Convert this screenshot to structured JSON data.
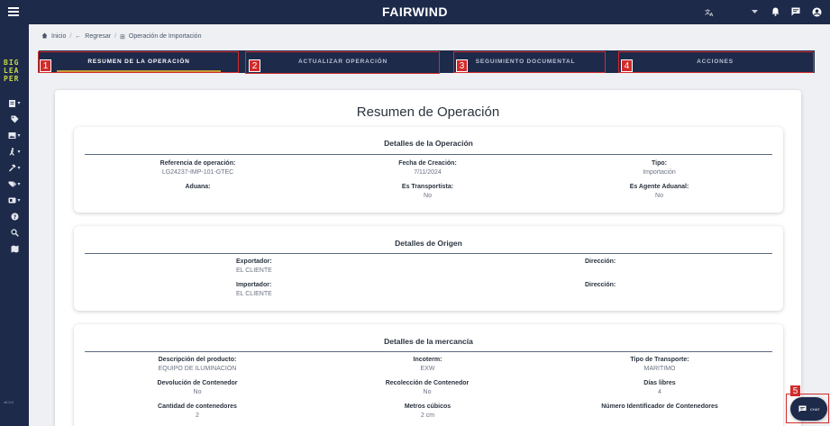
{
  "header": {
    "brand": "FAIRWIND",
    "icons": [
      "menu-icon",
      "translate-icon",
      "chevron-down-icon",
      "bell-icon",
      "message-icon",
      "account-icon"
    ]
  },
  "sidebar": {
    "logo": [
      "BIG",
      "LEA",
      "PER"
    ],
    "items": [
      {
        "icon": "clipboard-icon",
        "caret": true
      },
      {
        "icon": "tag-icon",
        "caret": false
      },
      {
        "icon": "image-icon",
        "caret": true
      },
      {
        "icon": "person-run-icon",
        "caret": true
      },
      {
        "icon": "hammer-icon",
        "caret": true
      },
      {
        "icon": "tags-icon",
        "caret": true
      },
      {
        "icon": "document-icon",
        "caret": true
      },
      {
        "icon": "help-icon",
        "caret": false
      },
      {
        "icon": "search-icon",
        "caret": false
      },
      {
        "icon": "map-icon",
        "caret": false
      }
    ],
    "footer": "v0.0.0"
  },
  "breadcrumb": {
    "home": "Inicio",
    "back": "Regresar",
    "current": "Operación de Importación"
  },
  "tabs": [
    {
      "label": "RESUMEN DE LA OPERACIÓN",
      "marker": "1"
    },
    {
      "label": "ACTUALIZAR OPERACIÓN",
      "marker": "2"
    },
    {
      "label": "SEGUIMIENTO DOCUMENTAL",
      "marker": "3"
    },
    {
      "label": "ACCIONES",
      "marker": "4"
    }
  ],
  "page": {
    "title": "Resumen de Operación"
  },
  "operation": {
    "title": "Detalles de la Operación",
    "referencia_label": "Referencia de operación:",
    "referencia_value": "LG24237-IMP-101-GTEC",
    "fecha_label": "Fecha de Creación:",
    "fecha_value": "7/11/2024",
    "tipo_label": "Tipo:",
    "tipo_value": "Importación",
    "aduana_label": "Aduana:",
    "transportista_label": "Es Transportista:",
    "transportista_value": "No",
    "agente_label": "Es Agente Aduanal:",
    "agente_value": "No"
  },
  "origin": {
    "title": "Detalles de Origen",
    "exportador_label": "Exportador:",
    "exportador_value": "EL CLIENTE",
    "direccion1_label": "Dirección:",
    "importador_label": "Importador:",
    "importador_value": "EL CLIENTE",
    "direccion2_label": "Dirección:"
  },
  "goods": {
    "title": "Detalles de la mercancía",
    "descripcion_label": "Descripción del producto:",
    "descripcion_value": "EQUIPO DE ILUMINACION",
    "incoterm_label": "Incoterm:",
    "incoterm_value": "EXW",
    "transporte_label": "Tipo de Transporte:",
    "transporte_value": "MARITIMO",
    "devolucion_label": "Devolución de Contenedor",
    "devolucion_value": "No",
    "recoleccion_label": "Recolección de Contenedor",
    "recoleccion_value": "No",
    "dias_label": "Días libres",
    "dias_value": "4",
    "cantidad_label": "Cantidad de contenedores",
    "cantidad_value": "2",
    "metros_label": "Metros cúbicos",
    "metros_value": "2 cm",
    "numero_label": "Número Identificador de Contenedores"
  },
  "chat": {
    "label": "CHAT",
    "marker": "5"
  }
}
